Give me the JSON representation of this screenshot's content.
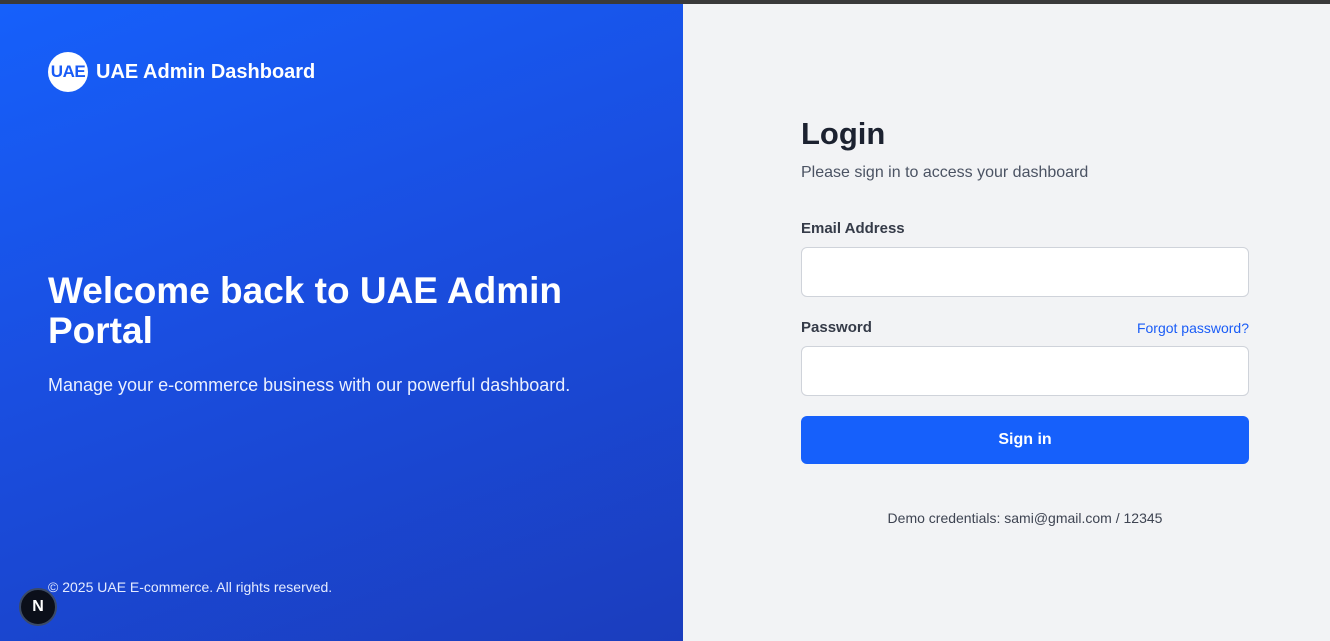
{
  "brand": {
    "logo_text": "UAE",
    "name": "UAE Admin Dashboard"
  },
  "hero": {
    "title": "Welcome back to UAE Admin Portal",
    "subtitle": "Manage your e-commerce business with our powerful dashboard."
  },
  "footer": {
    "copyright": "© 2025 UAE E-commerce. All rights reserved."
  },
  "dev_badge": {
    "label": "N"
  },
  "login": {
    "title": "Login",
    "subtitle": "Please sign in to access your dashboard",
    "email_label": "Email Address",
    "email_value": "",
    "password_label": "Password",
    "password_value": "",
    "forgot_label": "Forgot password?",
    "submit_label": "Sign in",
    "demo_text": "Demo credentials: sami@gmail.com / 12345"
  },
  "colors": {
    "brand_blue": "#1660fb",
    "panel_gradient_end": "#1b3dbd",
    "form_background": "#f2f3f5",
    "link": "#1a5cf6"
  }
}
